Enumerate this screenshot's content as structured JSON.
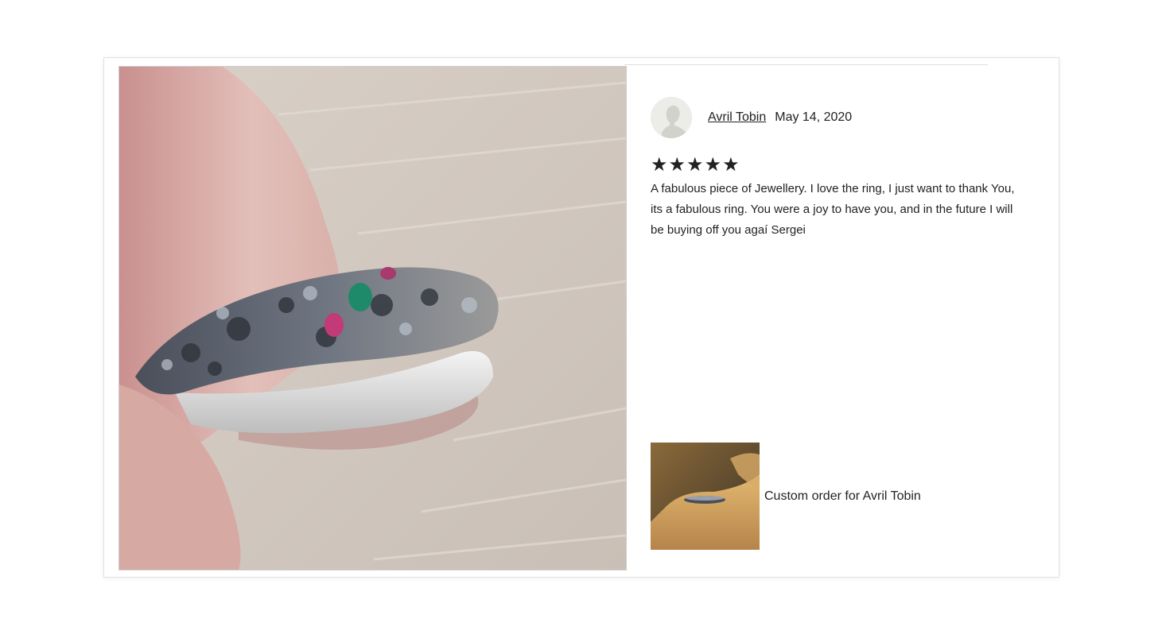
{
  "review": {
    "reviewer_name": "Avril Tobin",
    "date": "May 14, 2020",
    "rating": 5,
    "stars": [
      "★",
      "★",
      "★",
      "★",
      "★"
    ],
    "text": "A fabulous piece of Jewellery. I love the ring, I just want to thank You, its a fabulous ring. You were a joy to have you, and in the future I will be buying off you agaí Sergei"
  },
  "purchased_item": {
    "label": "Custom order for Avril Tobin"
  },
  "icons": {
    "avatar": "default-user-silhouette-icon",
    "star": "star-icon"
  },
  "colors": {
    "text": "#222222",
    "border": "#e1e1e1",
    "avatar_bg": "#ecece8"
  }
}
